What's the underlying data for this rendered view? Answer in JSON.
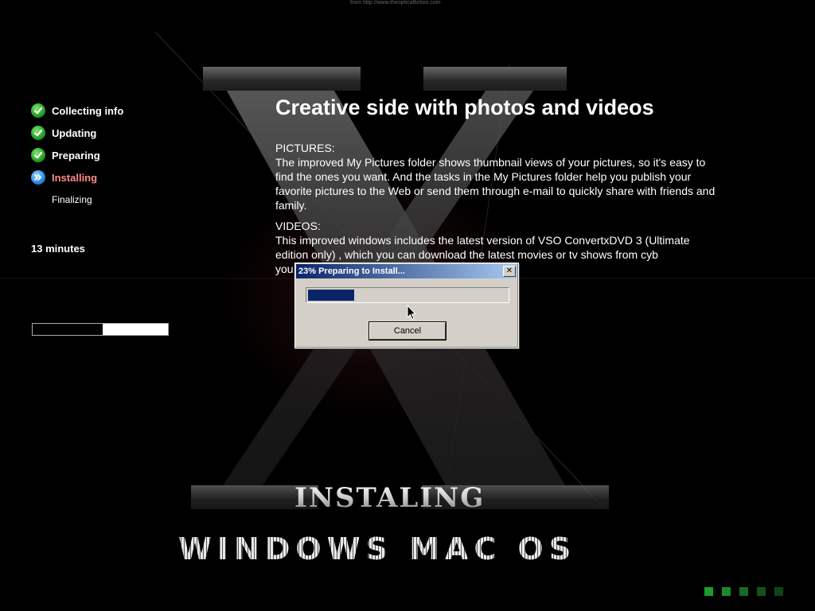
{
  "window": {
    "source_text": "from http://www.theopticalfiction.com"
  },
  "background": {
    "logo_letter": "X"
  },
  "sidebar": {
    "steps": [
      {
        "label": "Collecting info",
        "state": "done",
        "icon": "check-icon"
      },
      {
        "label": "Updating",
        "state": "done",
        "icon": "check-icon"
      },
      {
        "label": "Preparing",
        "state": "done",
        "icon": "check-icon"
      },
      {
        "label": "Installing",
        "state": "current",
        "icon": "arrow-right-icon"
      },
      {
        "label": "Finalizing",
        "state": "pending",
        "icon": ""
      }
    ],
    "time_remaining": "13 minutes",
    "progress_fraction": 0.52
  },
  "content": {
    "headline": "Creative side with photos and videos",
    "sections": [
      {
        "title": "PICTURES:",
        "text": "The improved My Pictures folder shows thumbnail views of your pictures, so it's easy to find the ones you want. And the tasks in the My Pictures folder help you publish your favorite pictures to the Web or send them through e-mail to quickly share with friends and family."
      },
      {
        "title": "VIDEOS:",
        "text": "This improved windows includes the latest version of VSO ConvertxDVD 3 (Ultimate edition only) , which you can download the latest movies or tv shows from cyb                                           you can playback on your DVD player"
      }
    ]
  },
  "dialog": {
    "title": "23% Preparing to Install...",
    "close_glyph": "✕",
    "progress_fraction": 0.23,
    "cancel_label": "Cancel"
  },
  "footer": {
    "installing_text": "INSTALING",
    "product_text": "WINDOWS MAC OS",
    "dots": [
      {
        "color": "#1e9a2e"
      },
      {
        "color": "#1a8a29"
      },
      {
        "color": "#176b22"
      },
      {
        "color": "#13521b"
      },
      {
        "color": "#0f4416"
      }
    ]
  },
  "colors": {
    "accent_current": "#ff8a8a",
    "dialog_progress": "#0a246a"
  }
}
